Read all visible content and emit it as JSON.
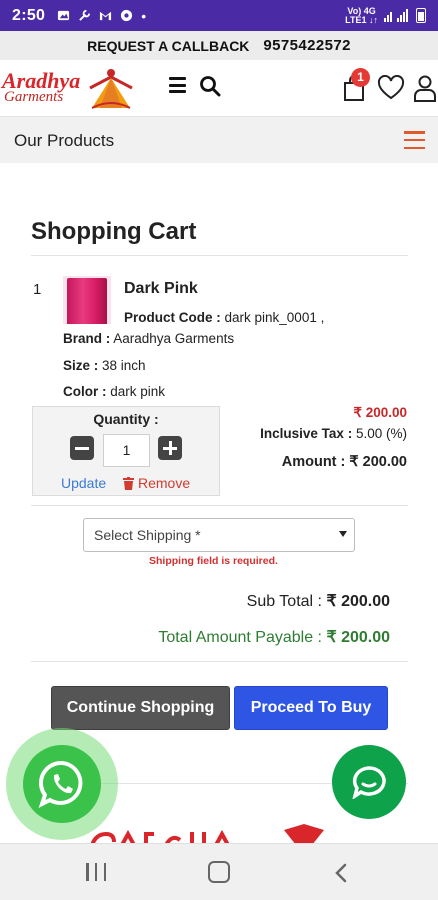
{
  "status_bar": {
    "time": "2:50",
    "network_top": "Vo) 4G",
    "network_bottom": "LTE1 ↓↑"
  },
  "callback_bar": {
    "label": "REQUEST A CALLBACK",
    "phone": "9575422572"
  },
  "header": {
    "logo_line1": "Aradhya",
    "logo_line2": "Garments",
    "cart_count": "1",
    "icons": [
      "menu-icon",
      "search-icon",
      "cart-icon",
      "heart-icon",
      "user-icon"
    ]
  },
  "products_bar": {
    "label": "Our Products"
  },
  "cart": {
    "title": "Shopping Cart",
    "item": {
      "index": "1",
      "name": "Dark Pink",
      "product_code_label": "Product Code :",
      "product_code": "dark pink_0001 ,",
      "brand_label": "Brand :",
      "brand": "Aaradhya Garments",
      "size_label": "Size :",
      "size": "38 inch",
      "color_label": "Color :",
      "color": "dark pink",
      "quantity_label": "Quantity :",
      "quantity": "1",
      "update_label": "Update",
      "remove_label": "Remove",
      "price": "₹ 200.00",
      "tax_label": "Inclusive Tax :",
      "tax": "5.00 (%)",
      "amount_label": "Amount :",
      "amount": "₹ 200.00"
    },
    "shipping": {
      "placeholder": "Select Shipping *",
      "error": "Shipping field is required."
    },
    "subtotal_label": "Sub Total :",
    "subtotal": "₹ 200.00",
    "total_label": "Total Amount Payable :",
    "total": "₹ 200.00",
    "continue_label": "Continue Shopping",
    "buy_label": "Proceed To Buy"
  },
  "colors": {
    "status_bar": "#4b2ba5",
    "price_red": "#c62828",
    "total_green": "#2e7d32",
    "buy_blue": "#2f55e4",
    "continue_gray": "#555555",
    "whatsapp_green": "#3ac24a",
    "chat_green": "#0ea24a"
  }
}
